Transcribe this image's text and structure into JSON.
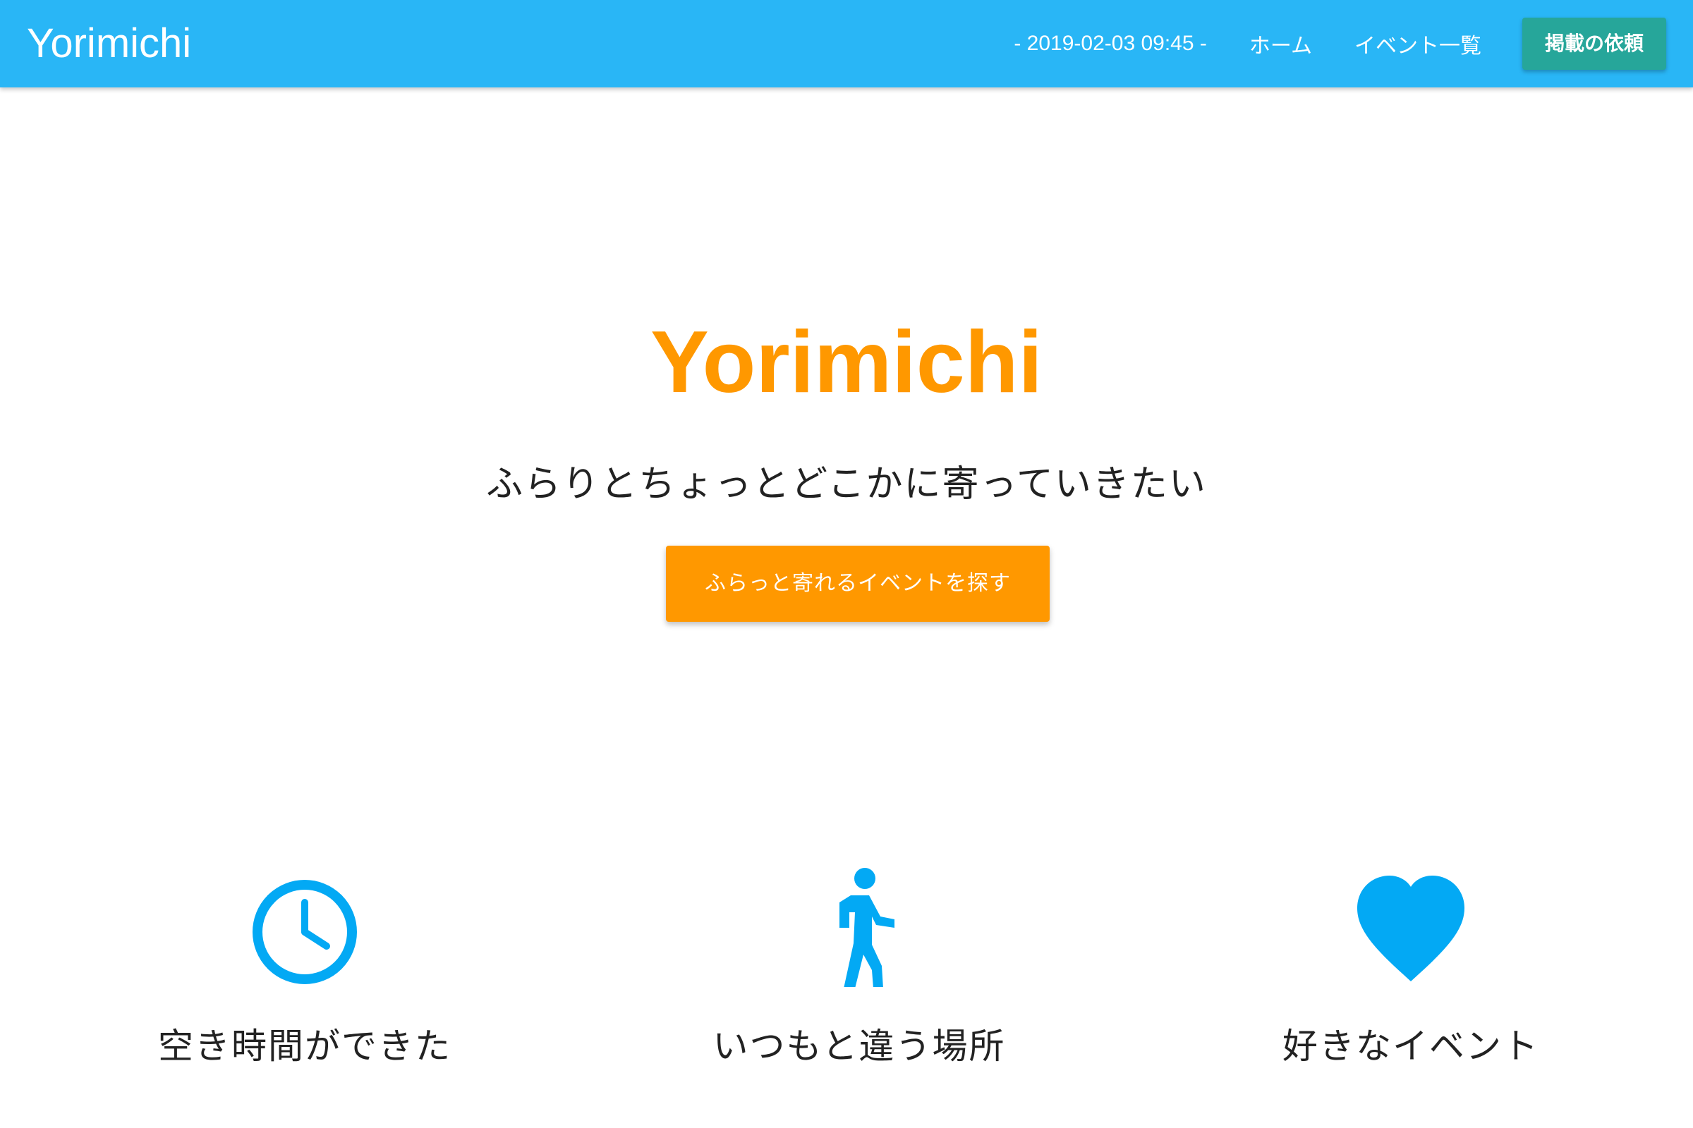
{
  "navbar": {
    "brand": "Yorimichi",
    "datetime": "- 2019-02-03 09:45 -",
    "links": [
      {
        "label": "ホーム"
      },
      {
        "label": "イベント一覧"
      }
    ],
    "cta_label": "掲載の依頼",
    "background_color": "#29b6f6",
    "cta_color": "#26a69a"
  },
  "hero": {
    "title": "Yorimichi",
    "tagline": "ふらりとちょっとどこかに寄っていきたい",
    "cta_label": "ふらっと寄れるイベントを探す",
    "accent_color": "#ff9800"
  },
  "features": [
    {
      "icon": "clock-icon",
      "label": "空き時間ができた"
    },
    {
      "icon": "walking-person-icon",
      "label": "いつもと違う場所"
    },
    {
      "icon": "heart-icon",
      "label": "好きなイベント"
    }
  ],
  "icon_color": "#03a9f4"
}
